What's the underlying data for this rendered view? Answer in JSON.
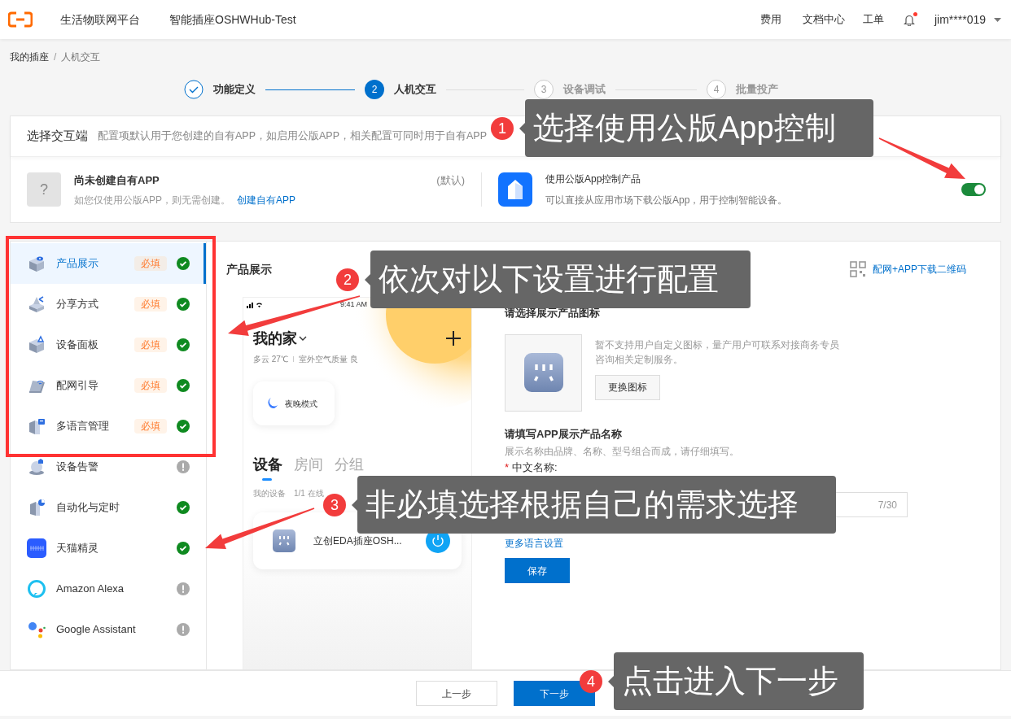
{
  "header": {
    "platform": "生活物联网平台",
    "product": "智能插座OSHWHub-Test",
    "nav": [
      "费用",
      "文档中心",
      "工单"
    ],
    "notification_dot": true,
    "user": "jim****019"
  },
  "breadcrumb": {
    "items": [
      "我的插座",
      "人机交互"
    ],
    "separator": "/"
  },
  "steps": [
    {
      "label": "功能定义",
      "completed": true,
      "selected": false
    },
    {
      "number": "2",
      "label": "人机交互",
      "completed": false,
      "selected": true
    },
    {
      "number": "3",
      "label": "设备调试",
      "completed": false,
      "selected": false
    },
    {
      "number": "4",
      "label": "批量投产",
      "completed": false,
      "selected": false
    }
  ],
  "endpoint_card": {
    "title": "选择交互端",
    "description": "配置项默认用于您创建的自有APP，如启用公版APP，相关配置可同时用于自有APP",
    "own_app": {
      "icon_glyph": "?",
      "title": "尚未创建自有APP",
      "tag": "(默认)",
      "note": "如您仅使用公版APP，则无需创建。",
      "link": "创建自有APP"
    },
    "public_app": {
      "title": "使用公版App控制产品",
      "note": "可以直接从应用市场下载公版App，用于控制智能设备。",
      "on": true
    }
  },
  "sidebar": {
    "items": [
      {
        "label": "产品展示",
        "badge": "必填",
        "complete": true,
        "selected": true
      },
      {
        "label": "分享方式",
        "badge": "必填",
        "complete": true,
        "selected": false
      },
      {
        "label": "设备面板",
        "badge": "必填",
        "complete": true,
        "selected": false
      },
      {
        "label": "配网引导",
        "badge": "必填",
        "complete": true,
        "selected": false
      },
      {
        "label": "多语言管理",
        "badge": "必填",
        "complete": true,
        "selected": false
      },
      {
        "label": "设备告警",
        "complete": false,
        "selected": false
      },
      {
        "label": "自动化与定时",
        "complete": true,
        "selected": false
      },
      {
        "label": "天猫精灵",
        "complete": true,
        "selected": false
      },
      {
        "label": "Amazon Alexa",
        "complete": false,
        "selected": false
      },
      {
        "label": "Google Assistant",
        "complete": false,
        "selected": false
      }
    ]
  },
  "preview": {
    "title": "产品展示",
    "qr_link": "配网+APP下载二维码",
    "phone": {
      "time": "9:41 AM",
      "home": "我的家",
      "weather": "多云 27℃",
      "air": "室外空气质量 良",
      "scene": "夜晚模式",
      "tabs": [
        {
          "label": "设备",
          "selected": true
        },
        {
          "label": "房间",
          "selected": false
        },
        {
          "label": "分组",
          "selected": false
        }
      ],
      "device_list_label": "我的设备",
      "online": "1/1 在线",
      "device": "立创EDA插座OSH..."
    }
  },
  "icon_section": {
    "title": "请选择展示产品图标",
    "note": "暂不支持用户自定义图标，量产用户可联系对接商务专员咨询相关定制服务。",
    "button": "更换图标"
  },
  "name_section": {
    "title": "请填写APP展示产品名称",
    "hint": "展示名称由品牌、名称、型号组合而成，请仔细填写。",
    "required_mark": "*",
    "field_label": "中文名称:",
    "counter": "7/30",
    "more_link": "更多语言设置",
    "save": "保存"
  },
  "footer": {
    "prev": "上一步",
    "next": "下一步"
  },
  "annotations": [
    {
      "number": "1",
      "text": "选择使用公版App控制"
    },
    {
      "number": "2",
      "text": "依次对以下设置进行配置"
    },
    {
      "number": "3",
      "text": "非必填选择根据自己的需求选择"
    },
    {
      "number": "4",
      "text": "点击进入下一步"
    }
  ]
}
